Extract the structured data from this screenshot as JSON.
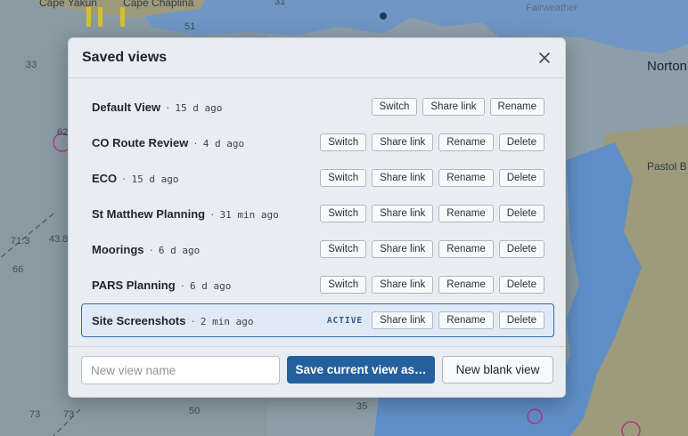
{
  "map": {
    "labels": {
      "cape_yakun": "Cape Yakun",
      "cape_chaplina": "Cape Chaplina",
      "fairweather": "Fairweather",
      "norton": "Norton",
      "pastol": "Pastol B",
      "d31": "31",
      "d33": "33",
      "d51": "51",
      "d62": "62",
      "d71_3": "71.3",
      "d43_8": "43.8",
      "d66": "66",
      "d73a": "73",
      "d73b": "73",
      "d50": "50",
      "d35": "35"
    }
  },
  "modal": {
    "title": "Saved views",
    "close_icon": "close-icon",
    "views": [
      {
        "name": "Default View",
        "age": "15 d ago",
        "active": false,
        "actions": [
          "Switch",
          "Share link",
          "Rename"
        ]
      },
      {
        "name": "CO Route Review",
        "age": "4 d ago",
        "active": false,
        "actions": [
          "Switch",
          "Share link",
          "Rename",
          "Delete"
        ]
      },
      {
        "name": "ECO",
        "age": "15 d ago",
        "active": false,
        "actions": [
          "Switch",
          "Share link",
          "Rename",
          "Delete"
        ]
      },
      {
        "name": "St Matthew Planning",
        "age": "31 min ago",
        "active": false,
        "actions": [
          "Switch",
          "Share link",
          "Rename",
          "Delete"
        ]
      },
      {
        "name": "Moorings",
        "age": "6 d ago",
        "active": false,
        "actions": [
          "Switch",
          "Share link",
          "Rename",
          "Delete"
        ]
      },
      {
        "name": "PARS Planning",
        "age": "6 d ago",
        "active": false,
        "actions": [
          "Switch",
          "Share link",
          "Rename",
          "Delete"
        ]
      },
      {
        "name": "Site Screenshots",
        "age": "2 min ago",
        "active": true,
        "active_label": "ACTIVE",
        "actions": [
          "Share link",
          "Rename",
          "Delete"
        ]
      }
    ],
    "separator": "·",
    "footer": {
      "input_placeholder": "New view name",
      "input_value": "",
      "save_label": "Save current view as…",
      "new_blank_label": "New blank view"
    }
  },
  "colors": {
    "accent": "#24609e",
    "active_row_bg": "#dfeaf6",
    "active_border": "#2b6bb1"
  }
}
